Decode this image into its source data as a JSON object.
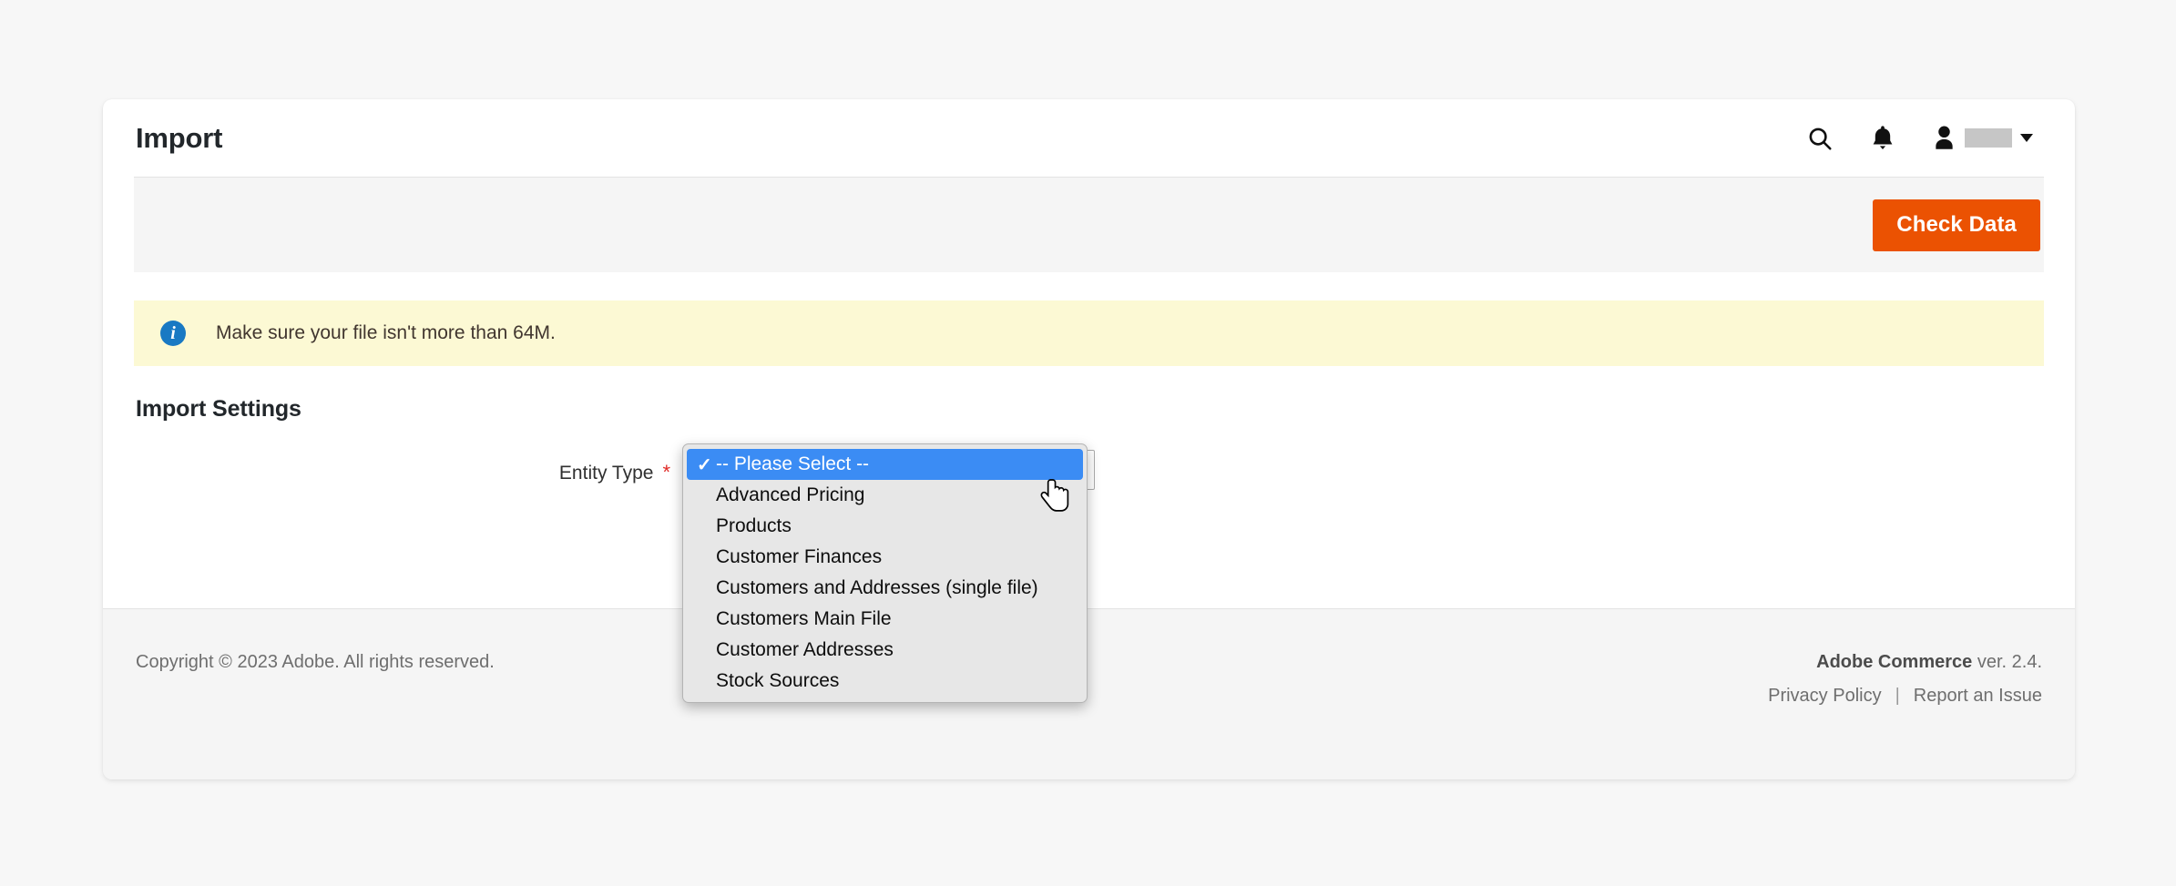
{
  "header": {
    "title": "Import",
    "icons": {
      "search": "search-icon",
      "notifications": "bell-icon",
      "account": "person-icon",
      "account_caret": "chevron-down-icon"
    },
    "username_redacted": ""
  },
  "toolbar": {
    "check_data_label": "Check Data"
  },
  "banner": {
    "icon": "info-icon",
    "message": "Make sure your file isn't more than 64M."
  },
  "import_settings": {
    "section_title": "Import Settings",
    "entity_type": {
      "label": "Entity Type",
      "required_marker": "*",
      "selected_value": "-- Please Select --",
      "options": [
        "-- Please Select --",
        "Advanced Pricing",
        "Products",
        "Customer Finances",
        "Customers and Addresses (single file)",
        "Customers Main File",
        "Customer Addresses",
        "Stock Sources"
      ],
      "selected_index": 0,
      "check_glyph": "✓",
      "menu_open": true
    }
  },
  "footer": {
    "copyright": "Copyright © 2023 Adobe. All rights reserved.",
    "product_name": "Adobe Commerce",
    "version_text": "ver. 2.4.",
    "privacy_policy": "Privacy Policy",
    "separator": "|",
    "report_issue": "Report an Issue"
  },
  "colors": {
    "accent_orange": "#eb5202",
    "banner_yellow": "#fcf9d4",
    "info_blue": "#1979c3",
    "selection_blue": "#3b8cf4",
    "required_red": "#e02b27",
    "page_background": "#f7f7f7"
  }
}
